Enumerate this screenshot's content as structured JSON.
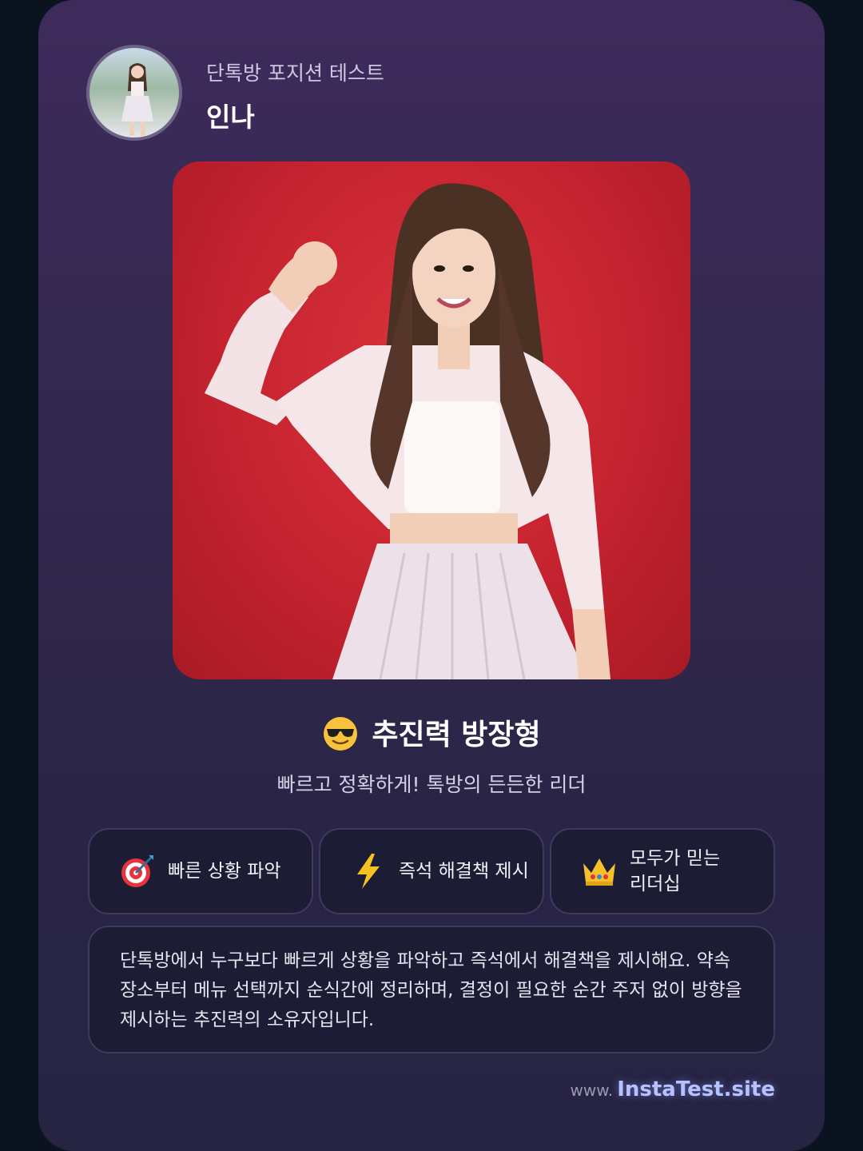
{
  "header": {
    "subtitle": "단톡방 포지션 테스트",
    "name": "인나",
    "avatar_icon": "avatar-photo"
  },
  "photo": {
    "icon": "flexing-woman-photo",
    "background": "#c62330"
  },
  "result": {
    "emoji_icon": "sunglasses-emoji-icon",
    "title": "추진력 방장형",
    "subtitle": "빠르고 정확하게! 톡방의 든든한 리더"
  },
  "traits": [
    {
      "icon": "target-dart-icon",
      "label": "빠른 상황 파악"
    },
    {
      "icon": "lightning-icon",
      "label": "즉석 해결책 제시"
    },
    {
      "icon": "crown-icon",
      "label": "모두가 믿는 리더십"
    }
  ],
  "description": "단톡방에서 누구보다 빠르게 상황을 파악하고 즉석에서 해결책을 제시해요. 약속 장소부터 메뉴 선택까지 순식간에 정리하며, 결정이 필요한 순간 주저 없이 방향을 제시하는 추진력의 소유자입니다.",
  "footer": {
    "prefix": "www.",
    "site": "InstaTest.site"
  }
}
